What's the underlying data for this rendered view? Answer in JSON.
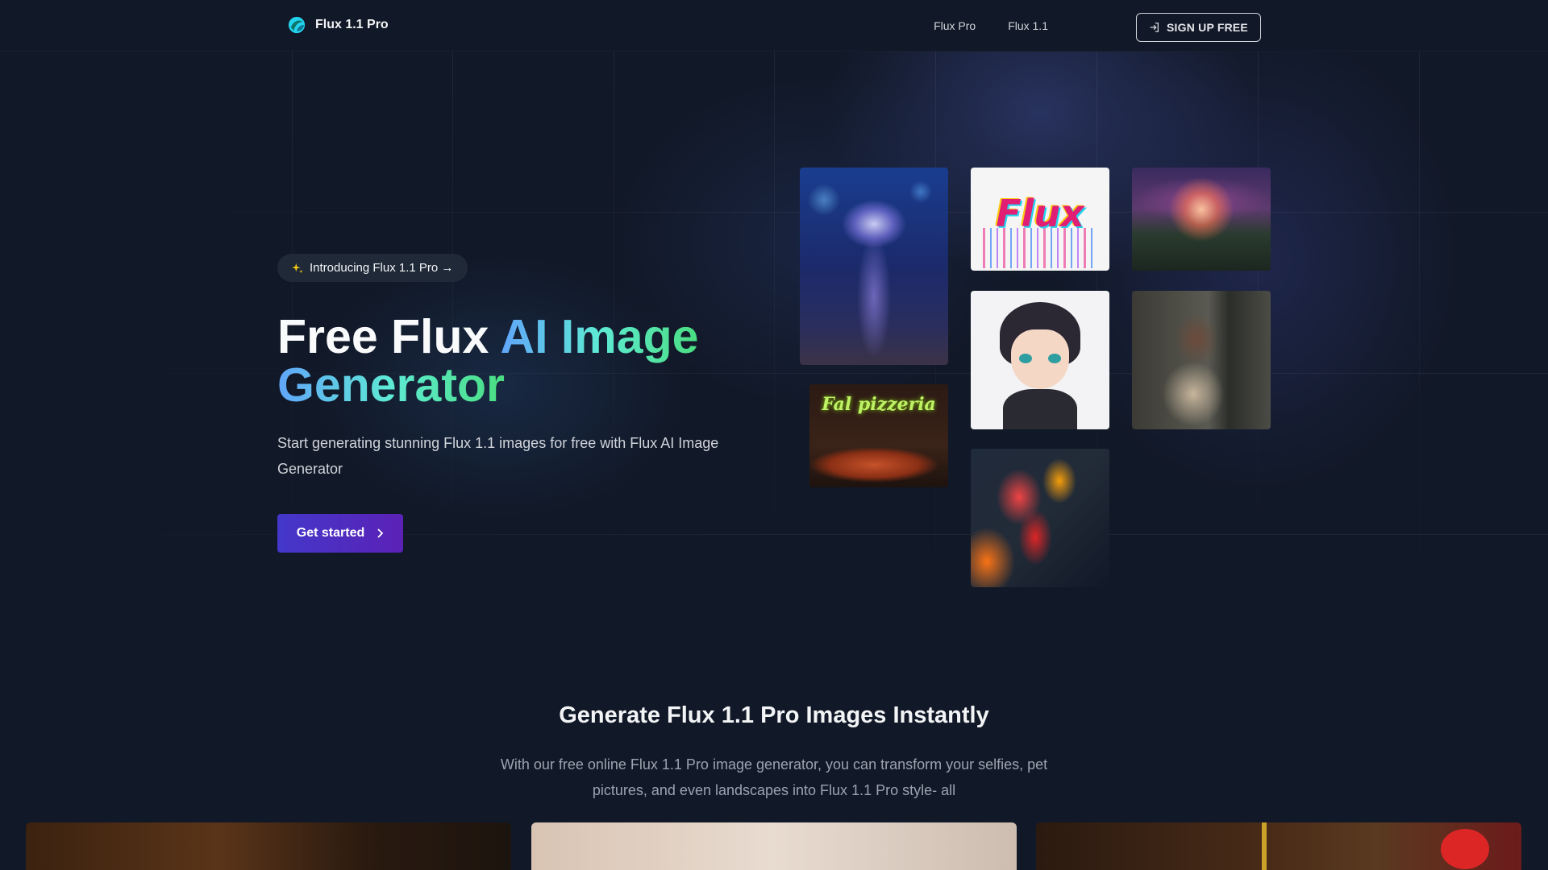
{
  "header": {
    "brand": "Flux 1.1 Pro",
    "nav": [
      "Flux Pro",
      "Flux 1.1"
    ],
    "signup_label": "SIGN UP FREE"
  },
  "hero": {
    "badge": "Introducing Flux 1.1 Pro →",
    "title_plain": "Free Flux ",
    "title_gradient_1": "AI Image",
    "title_gradient_2": "Generator",
    "subtitle": "Start generating stunning Flux 1.1 images for free with Flux AI Image Generator",
    "cta_label": "Get started"
  },
  "gallery": {
    "flux_art_text": "Flux",
    "pizza_sign_text": "Fal pizzeria"
  },
  "section2": {
    "title": "Generate Flux 1.1 Pro Images Instantly",
    "subtitle": "With our free online Flux 1.1 Pro image generator, you can transform your selfies, pet pictures, and even landscapes into Flux 1.1 Pro style- all"
  },
  "colors": {
    "background": "#111827",
    "accent_gradient_start": "#4338ca",
    "accent_gradient_end": "#5b21b6",
    "title_gradient": [
      "#60a5fa",
      "#5eead4",
      "#4ade80"
    ]
  },
  "icons": {
    "brand": "flux-logo-icon",
    "signup": "sign-in-icon",
    "badge": "sparkles-icon",
    "cta": "chevron-right-icon"
  }
}
